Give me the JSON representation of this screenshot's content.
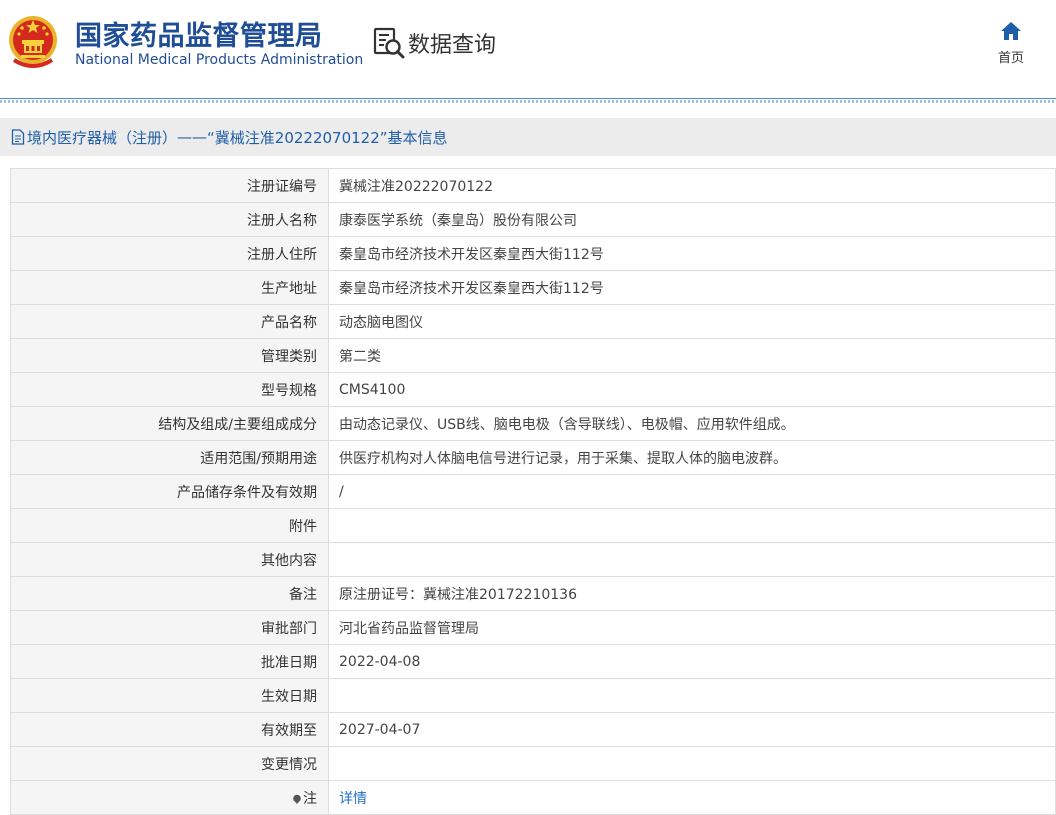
{
  "header": {
    "org_name_cn": "国家药品监督管理局",
    "org_name_en": "National Medical Products Administration",
    "query_label": "数据查询",
    "home_label": "首页",
    "brand_color": "#1f4e96"
  },
  "title": {
    "category": "境内医疗器械（注册）",
    "separator": " —— ",
    "record": "“冀械注准20222070122”基本信息"
  },
  "fields": [
    {
      "label": "注册证编号",
      "value": "冀械注准20222070122"
    },
    {
      "label": "注册人名称",
      "value": "康泰医学系统（秦皇岛）股份有限公司"
    },
    {
      "label": "注册人住所",
      "value": "秦皇岛市经济技术开发区秦皇西大街112号"
    },
    {
      "label": "生产地址",
      "value": "秦皇岛市经济技术开发区秦皇西大街112号"
    },
    {
      "label": "产品名称",
      "value": "动态脑电图仪"
    },
    {
      "label": "管理类别",
      "value": "第二类"
    },
    {
      "label": "型号规格",
      "value": "CMS4100"
    },
    {
      "label": "结构及组成/主要组成成分",
      "value": "由动态记录仪、USB线、脑电电极（含导联线）、电极帽、应用软件组成。"
    },
    {
      "label": "适用范围/预期用途",
      "value": "供医疗机构对人体脑电信号进行记录，用于采集、提取人体的脑电波群。"
    },
    {
      "label": "产品储存条件及有效期",
      "value": "/"
    },
    {
      "label": "附件",
      "value": ""
    },
    {
      "label": "其他内容",
      "value": ""
    },
    {
      "label": "备注",
      "value": "原注册证号：冀械注准20172210136"
    },
    {
      "label": "审批部门",
      "value": "河北省药品监督管理局"
    },
    {
      "label": "批准日期",
      "value": "2022-04-08"
    },
    {
      "label": "生效日期",
      "value": ""
    },
    {
      "label": "有效期至",
      "value": "2027-04-07"
    },
    {
      "label": "变更情况",
      "value": ""
    },
    {
      "label": "注",
      "value": "详情"
    }
  ]
}
